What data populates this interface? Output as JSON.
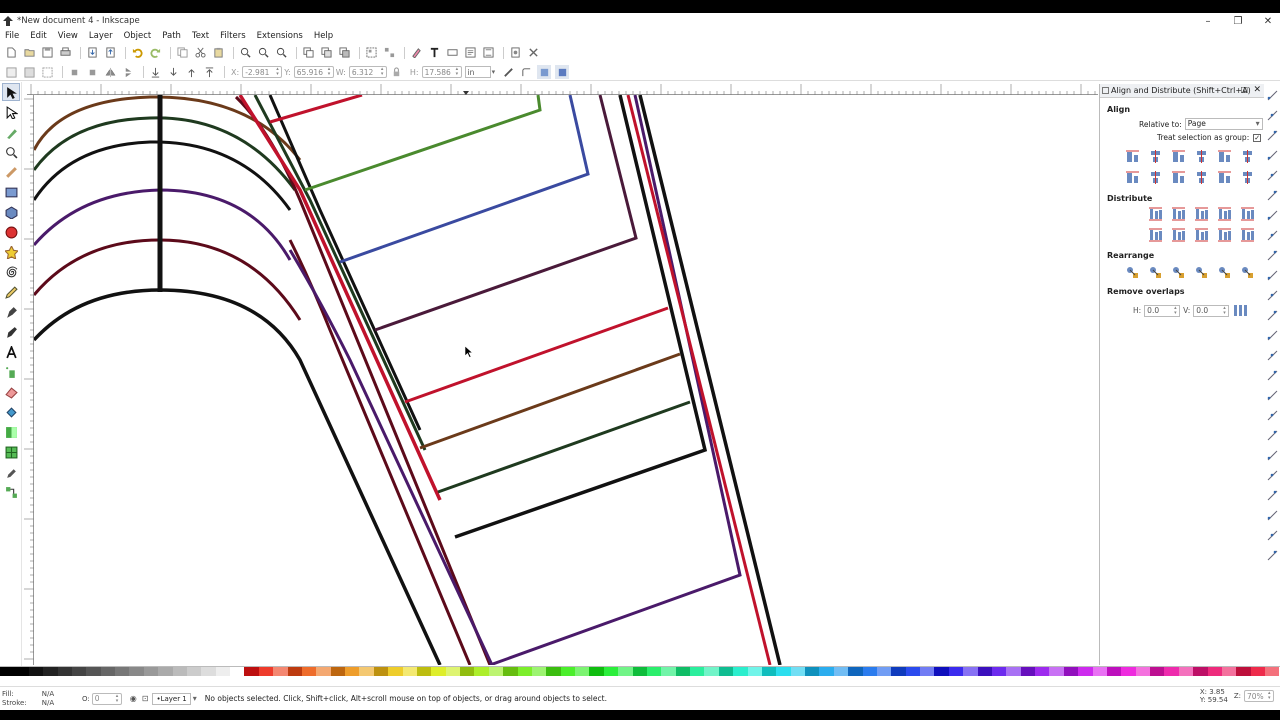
{
  "window": {
    "title": "*New document 4 - Inkscape",
    "minimize": "–",
    "maximize": "❐",
    "close": "✕"
  },
  "menu": [
    "File",
    "Edit",
    "View",
    "Layer",
    "Object",
    "Path",
    "Text",
    "Filters",
    "Extensions",
    "Help"
  ],
  "controls": {
    "x_label": "X:",
    "x_value": "-2.981",
    "y_label": "Y:",
    "y_value": "65.916",
    "w_label": "W:",
    "w_value": "6.312",
    "h_label": "H:",
    "h_value": "17.586",
    "unit": "in"
  },
  "dock": {
    "title": "Align and Distribute (Shift+Ctrl+A)",
    "align_label": "Align",
    "relative_to_label": "Relative to:",
    "relative_to_value": "Page",
    "treat_as_group_label": "Treat selection as group:",
    "treat_as_group_checked": "✓",
    "distribute_label": "Distribute",
    "rearrange_label": "Rearrange",
    "remove_overlaps_label": "Remove overlaps",
    "h_label": "H:",
    "h_value": "0.0",
    "v_label": "V:",
    "v_value": "0.0"
  },
  "status": {
    "fill_label": "Fill:",
    "fill_value": "N/A",
    "stroke_label": "Stroke:",
    "stroke_value": "N/A",
    "opacity_label": "O:",
    "opacity_value": "0",
    "layer": "•Layer 1",
    "message": "No objects selected. Click, Shift+click, Alt+scroll mouse on top of objects, or drag around objects to select.",
    "x_label": "X:",
    "x_value": "3.85",
    "y_label": "Y:",
    "y_value": "59.54",
    "zoom_label": "Z:",
    "zoom_value": "70%"
  },
  "colors": {
    "red": "#c0122c",
    "darkred": "#5c0a1a",
    "brown": "#6b3a1a",
    "darkgreen": "#1f3a1f",
    "green": "#4a8a2e",
    "blue": "#3a4aa0",
    "purple": "#4a1a6a",
    "plum": "#4a1a3a",
    "black": "#111111"
  }
}
